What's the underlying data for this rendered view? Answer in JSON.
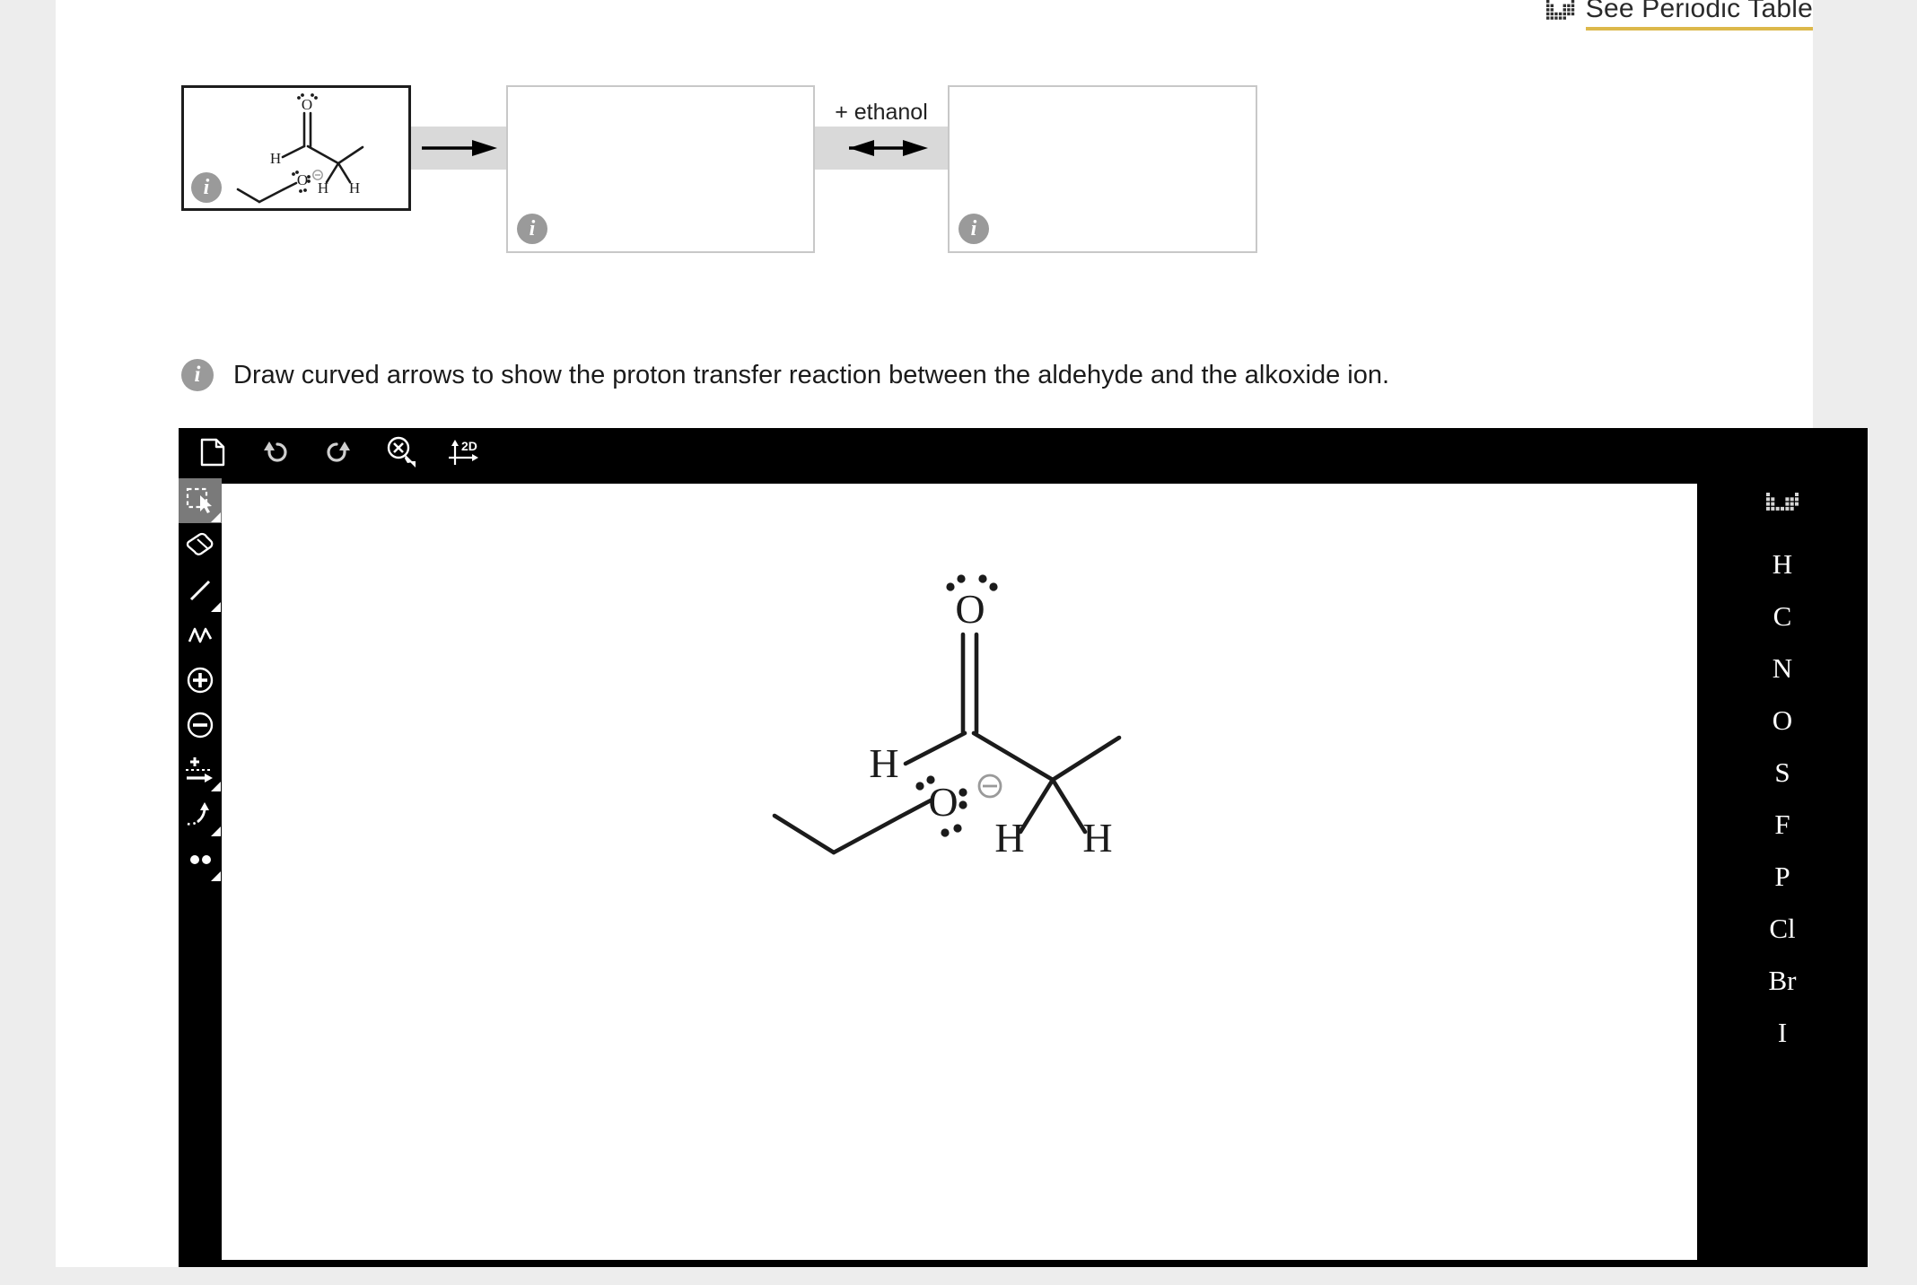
{
  "header": {
    "periodic_table_link": "See Periodic Table",
    "periodic_icon": "periodic-table-grid-icon",
    "underline_color": "#dcb84b"
  },
  "scheme": {
    "reactant_box": {
      "info_icon": "info-icon",
      "molecule": "propanal and ethoxide ion",
      "border_color": "#1d1d1d"
    },
    "arrow1": {
      "icon": "forward-arrow-icon",
      "label": ""
    },
    "product_box_1": {
      "info_icon": "info-icon",
      "content": ""
    },
    "arrow2": {
      "icon": "equilibrium-double-arrow-icon",
      "label": "+ ethanol"
    },
    "product_box_2": {
      "info_icon": "info-icon",
      "content": ""
    },
    "arrow_bar_color": "#d9d9d9"
  },
  "instruction": {
    "info_icon": "info-icon",
    "text": "Draw curved arrows to show the proton transfer reaction between the aldehyde and the alkoxide ion."
  },
  "editor": {
    "background": "#000000",
    "top_toolbar": [
      {
        "name": "new-document-button",
        "icon": "document-icon",
        "label": "New"
      },
      {
        "name": "undo-button",
        "icon": "undo-arrow-icon",
        "label": "Undo"
      },
      {
        "name": "redo-button",
        "icon": "redo-arrow-icon",
        "label": "Redo"
      },
      {
        "name": "erase-button",
        "icon": "erase-cursor-icon",
        "label": "Erase"
      },
      {
        "name": "toggle-2d-button",
        "icon": "axes-2d-icon",
        "label": "2D"
      }
    ],
    "left_toolbar": [
      {
        "name": "select-tool",
        "icon": "select-marquee-cursor-icon",
        "label": "Select",
        "active": true,
        "has_submenu": true
      },
      {
        "name": "eraser-tool",
        "icon": "eraser-icon",
        "label": "Eraser",
        "active": false,
        "has_submenu": false
      },
      {
        "name": "single-bond-tool",
        "icon": "single-bond-icon",
        "label": "Single Bond",
        "active": false,
        "has_submenu": true
      },
      {
        "name": "chain-tool",
        "icon": "chain-zigzag-icon",
        "label": "Chain",
        "active": false,
        "has_submenu": false
      },
      {
        "name": "increase-charge-tool",
        "icon": "plus-circle-icon",
        "label": "Add Positive Charge",
        "active": false,
        "has_submenu": false
      },
      {
        "name": "decrease-charge-tool",
        "icon": "minus-circle-icon",
        "label": "Add Negative Charge",
        "active": false,
        "has_submenu": false
      },
      {
        "name": "reaction-arrow-tool",
        "icon": "plus-reaction-arrow-icon",
        "label": "Reaction Arrow",
        "active": false,
        "has_submenu": true
      },
      {
        "name": "curved-arrow-tool",
        "icon": "curved-arrow-icon",
        "label": "Curved Arrow",
        "active": false,
        "has_submenu": true
      },
      {
        "name": "lone-pair-tool",
        "icon": "lone-pair-dots-icon",
        "label": "Lone Pair",
        "active": false,
        "has_submenu": true
      }
    ],
    "element_palette": {
      "grid_icon": "periodic-table-grid-icon",
      "elements": [
        "H",
        "C",
        "N",
        "O",
        "S",
        "F",
        "P",
        "Cl",
        "Br",
        "I"
      ]
    },
    "canvas": {
      "background": "#ffffff",
      "molecule_name": "propanal and ethoxide ion",
      "atom_labels": [
        "O",
        "H",
        "H",
        "H",
        "O"
      ],
      "charge_label": "⊖"
    }
  }
}
